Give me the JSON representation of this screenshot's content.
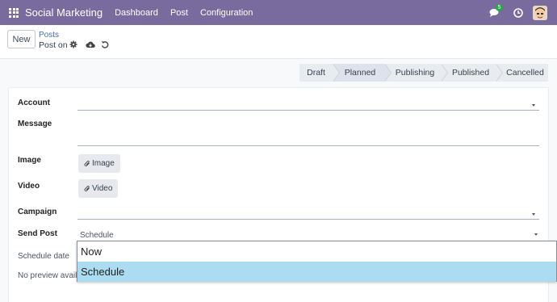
{
  "navbar": {
    "app_name": "Social Marketing",
    "menu": [
      "Dashboard",
      "Post",
      "Configuration"
    ],
    "messages_count": "5"
  },
  "control_panel": {
    "new_label": "New",
    "breadcrumb_parent": "Posts",
    "breadcrumb_current": "Post on"
  },
  "statusbar": {
    "steps": [
      "Draft",
      "Planned",
      "Publishing",
      "Published",
      "Cancelled"
    ],
    "active": "Planned"
  },
  "form": {
    "account_label": "Account",
    "message_label": "Message",
    "image_label": "Image",
    "image_button": "Image",
    "video_label": "Video",
    "video_button": "Video",
    "campaign_label": "Campaign",
    "send_post_label": "Send Post",
    "send_post_value": "Schedule",
    "schedule_date_label": "Schedule date",
    "no_preview_text": "No preview availa"
  },
  "dropdown": {
    "options": [
      "Now",
      "Schedule"
    ],
    "selected": "Schedule"
  }
}
